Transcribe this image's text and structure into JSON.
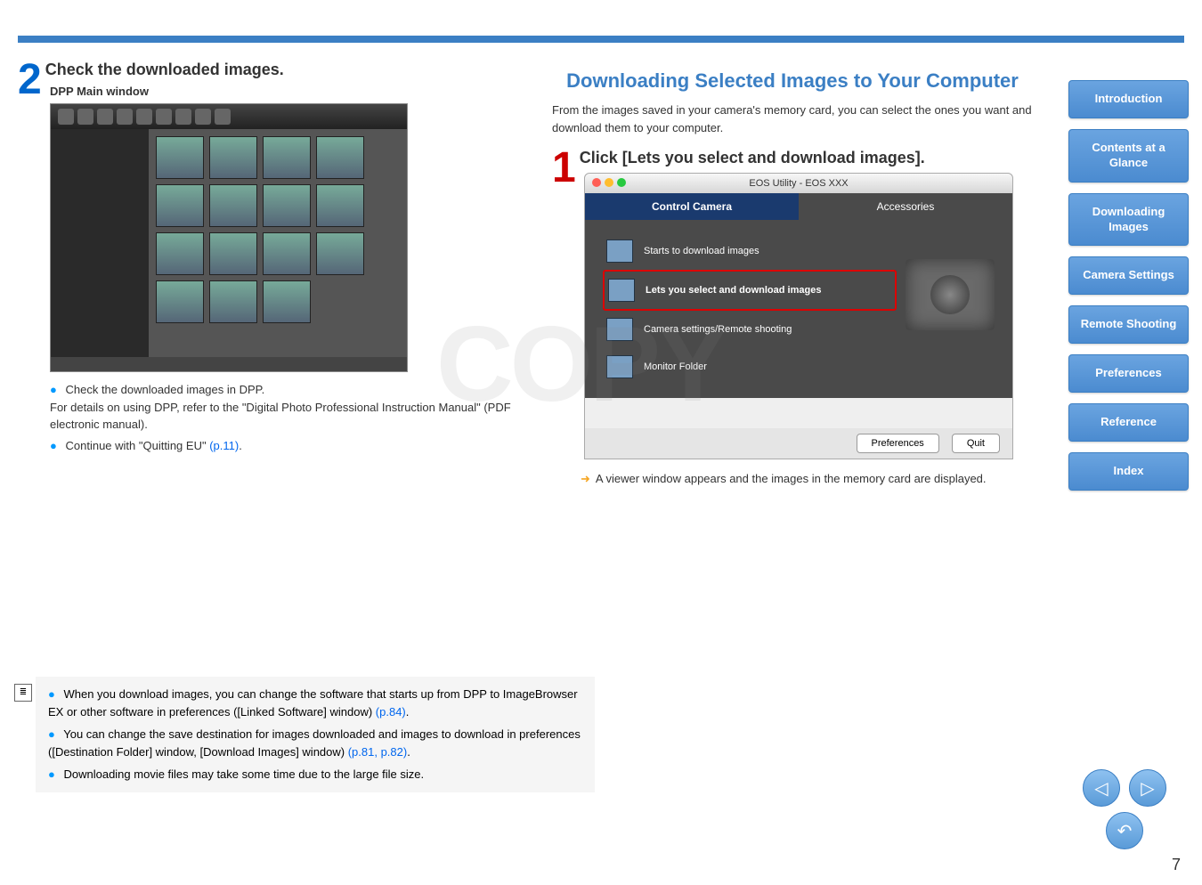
{
  "page_number": "7",
  "left": {
    "step_number": "2",
    "step_title": "Check the downloaded images.",
    "sub_title": "DPP Main window",
    "bullet1_pre": "Check the downloaded images in DPP.",
    "bullet1_line2": "For details on using DPP, refer to the \"Digital Photo Professional Instruction Manual\" (PDF electronic manual).",
    "bullet2_pre": "Continue with \"Quitting EU\" ",
    "bullet2_link": "(p.11)",
    "bullet2_post": "."
  },
  "right": {
    "section_title": "Downloading Selected Images to Your Computer",
    "intro": "From the images saved in your camera's memory card, you can select the ones you want and download them to your computer.",
    "step_number": "1",
    "step_title": "Click [Lets you select and download images].",
    "eu_title": "EOS Utility - EOS XXX",
    "tab_control": "Control Camera",
    "tab_accessories": "Accessories",
    "item_start": "Starts to download images",
    "item_select": "Lets you select and download images",
    "item_settings": "Camera settings/Remote shooting",
    "item_monitor": "Monitor Folder",
    "btn_prefs": "Preferences",
    "btn_quit": "Quit",
    "result_text": "A viewer window appears and the images in the memory card are displayed."
  },
  "notes": {
    "n1_pre": "When you download images, you can change the software that starts up from DPP to ImageBrowser EX or other software in preferences ([Linked Software] window) ",
    "n1_link": "(p.84)",
    "n1_post": ".",
    "n2_pre": "You can change the save destination for images downloaded and images to download in preferences ([Destination Folder] window, [Download Images] window) ",
    "n2_link": "(p.81, p.82)",
    "n2_post": ".",
    "n3": "Downloading movie files may take some time due to the large file size."
  },
  "sidebar": {
    "intro": "Introduction",
    "contents": "Contents at a Glance",
    "downloading": "Downloading Images",
    "camera": "Camera Settings",
    "remote": "Remote Shooting",
    "prefs": "Preferences",
    "reference": "Reference",
    "index": "Index"
  },
  "watermark": "COPY"
}
